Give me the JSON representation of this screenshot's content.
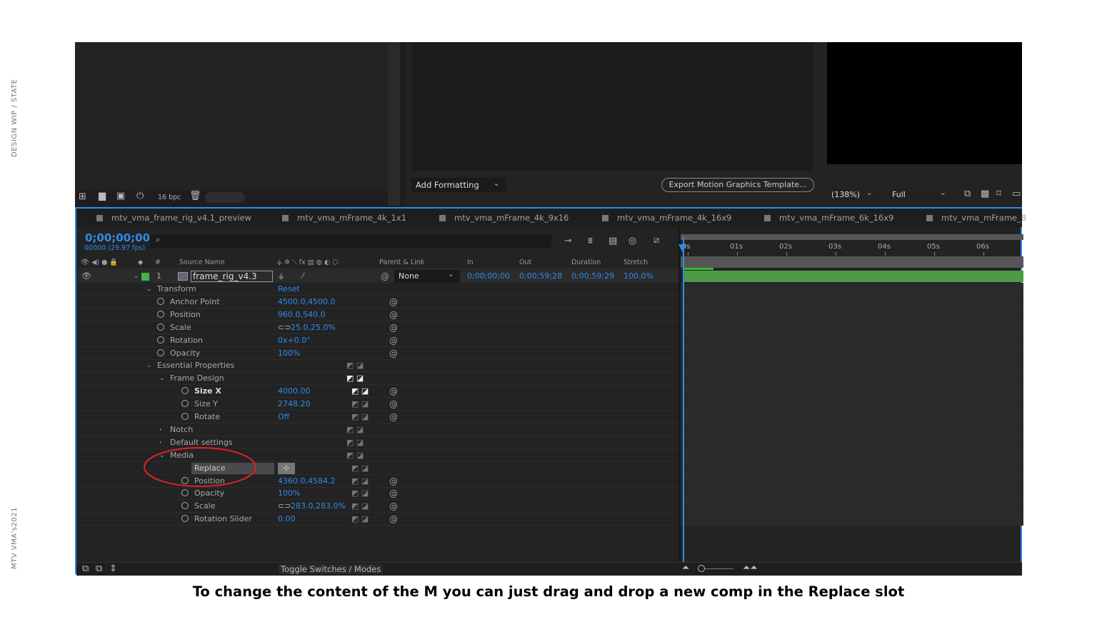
{
  "side_labels": {
    "top": "DESIGN WIP / STATE",
    "bottom": "MTV VMA's2021"
  },
  "caption": "To change the content of the M you can just drag and drop a new comp in the Replace slot",
  "project_panel": {
    "bpc": "16 bpc"
  },
  "egp_panel": {
    "add_formatting": "Add Formatting",
    "export_button": "Export Motion Graphics Template..."
  },
  "viewer": {
    "zoom": "(138%)",
    "resolution": "Full"
  },
  "tabs": [
    "mtv_vma_frame_rig_v4.1_preview",
    "mtv_vma_mFrame_4k_1x1",
    "mtv_vma_mFrame_4k_9x16",
    "mtv_vma_mFrame_4k_16x9",
    "mtv_vma_mFrame_6k_16x9",
    "mtv_vma_mFrame_8"
  ],
  "timeline": {
    "timecode": "0;00;00;00",
    "frame_info": "00000 (29.97 fps)",
    "search_placeholder": "",
    "ruler": [
      "0s",
      "01s",
      "02s",
      "03s",
      "04s",
      "05s",
      "06s"
    ],
    "columns": {
      "num": "#",
      "source": "Source Name",
      "parent": "Parent & Link",
      "in": "In",
      "out": "Out",
      "duration": "Duration",
      "stretch": "Stretch"
    },
    "layer": {
      "num": "1",
      "name": "frame_rig_v4.3",
      "parent": "None",
      "in": "0;00;00;00",
      "out": "0;00;59;28",
      "duration": "0;00;59;29",
      "stretch": "100.0%",
      "label_color": "#3fb54a"
    },
    "properties": [
      {
        "name": "Transform",
        "level": 0,
        "chev": "open",
        "value": "Reset"
      },
      {
        "name": "Anchor Point",
        "level": 1,
        "sw": true,
        "value": "4500.0,4500.0",
        "spiral": true
      },
      {
        "name": "Position",
        "level": 1,
        "sw": true,
        "value": "960.0,540.0",
        "spiral": true
      },
      {
        "name": "Scale",
        "level": 1,
        "sw": true,
        "value": "25.0,25.0%",
        "link": true,
        "spiral": true
      },
      {
        "name": "Rotation",
        "level": 1,
        "sw": true,
        "value": "0x+0.0°",
        "spiral": true
      },
      {
        "name": "Opacity",
        "level": 1,
        "sw": true,
        "value": "100%",
        "spiral": true
      },
      {
        "name": "Essential Properties",
        "level": 0,
        "chev": "open",
        "kf": true
      },
      {
        "name": "Frame Design",
        "level": 1,
        "chev": "open",
        "kf": true,
        "kfb": true
      },
      {
        "name": "Size X",
        "level": 2,
        "sw": true,
        "value": "4000.00",
        "kf": true,
        "kfb": true,
        "spiral": true,
        "bold": true
      },
      {
        "name": "Size Y",
        "level": 2,
        "sw": true,
        "value": "2748.20",
        "kf": true,
        "spiral": true
      },
      {
        "name": "Rotate",
        "level": 2,
        "sw": true,
        "value": "Off",
        "kf": true,
        "spiral": true
      },
      {
        "name": "Notch",
        "level": 1,
        "chev": "closed",
        "kf": true
      },
      {
        "name": "Default settings",
        "level": 1,
        "chev": "closed",
        "kf": true
      },
      {
        "name": "Media",
        "level": 1,
        "chev": "open",
        "kf": true
      },
      {
        "name": "Replace",
        "level": 2,
        "replace": true,
        "kf": true
      },
      {
        "name": "Position",
        "level": 2,
        "sw": true,
        "value": "4360.0,4584.2",
        "kf": true,
        "spiral": true
      },
      {
        "name": "Opacity",
        "level": 2,
        "sw": true,
        "value": "100%",
        "kf": true,
        "spiral": true
      },
      {
        "name": "Scale",
        "level": 2,
        "sw": true,
        "value": "283.0,283.0%",
        "link": true,
        "kf": true,
        "spiral": true
      },
      {
        "name": "Rotation Slider",
        "level": 2,
        "sw": true,
        "value": "0.00",
        "kf": true,
        "spiral": true
      }
    ],
    "toggle_label": "Toggle Switches / Modes"
  },
  "colors": {
    "accent": "#2d8ceb",
    "annotation": "#e0202a",
    "layer_bar": "#4d9a47"
  }
}
